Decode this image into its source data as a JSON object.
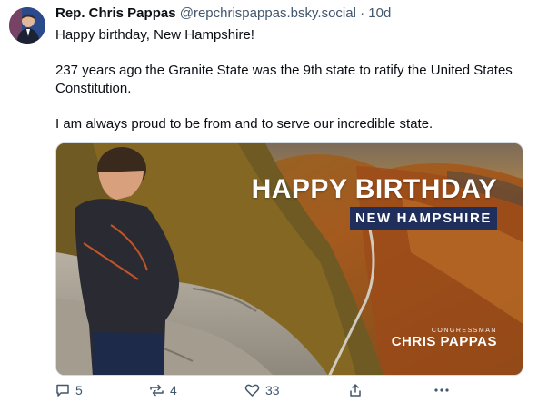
{
  "post": {
    "author": {
      "display_name": "Rep. Chris Pappas",
      "handle": "@repchrispappas.bsky.social",
      "separator": "·",
      "time": "10d"
    },
    "text": {
      "line1": "Happy birthday, New Hampshire!",
      "line2": "237 years ago the Granite State was the 9th state to ratify the United States Constitution.",
      "line3": "I am always proud to be from and to serve our incredible state."
    },
    "image": {
      "title": "HAPPY BIRTHDAY",
      "subtitle": "NEW HAMPSHIRE",
      "logo_small": "CONGRESSMAN",
      "logo_big": "CHRIS PAPPAS"
    },
    "actions": {
      "reply_count": "5",
      "repost_count": "4",
      "like_count": "33",
      "reply_icon": "reply-icon",
      "repost_icon": "repost-icon",
      "like_icon": "heart-icon",
      "share_icon": "share-icon",
      "more_icon": "more-icon"
    }
  },
  "colors": {
    "text": "#0b0f14",
    "secondary_text": "#42576c",
    "banner_blue": "#1f2e5a"
  }
}
